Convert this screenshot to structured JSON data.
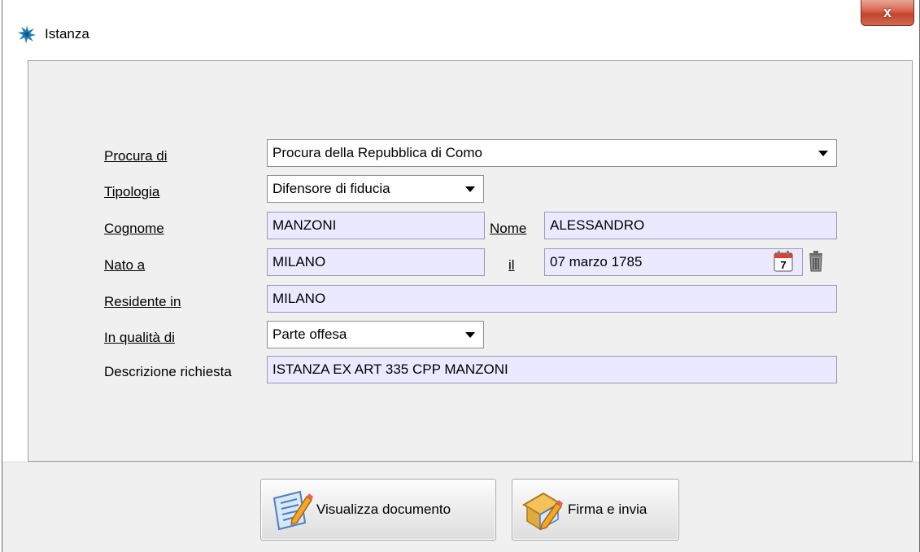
{
  "window": {
    "title": "Istanza",
    "close_label": "x"
  },
  "form": {
    "procura_label": "Procura di",
    "procura_value": "Procura della Repubblica di Como",
    "tipologia_label": "Tipologia",
    "tipologia_value": "Difensore di fiducia",
    "cognome_label": "Cognome",
    "cognome_value": "MANZONI",
    "nome_label": "Nome",
    "nome_value": "ALESSANDRO",
    "nato_label": "Nato a",
    "nato_value": "MILANO",
    "il_label": "il",
    "date_value": "07 marzo 1785",
    "calendar_day": "7",
    "residente_label": "Residente in",
    "residente_value": "MILANO",
    "qualita_label": "In qualità di",
    "qualita_value": "Parte offesa",
    "descrizione_label": "Descrizione richiesta",
    "descrizione_value": "ISTANZA EX ART 335 CPP MANZONI"
  },
  "buttons": {
    "visualizza_label": "Visualizza documento",
    "firma_label": "Firma e invia"
  },
  "icons": {
    "app": "app-logo-icon",
    "calendar": "calendar-icon",
    "trash": "trash-icon",
    "document": "edit-document-icon",
    "sign": "sign-send-icon"
  },
  "colors": {
    "field_bg": "#ebe9ff",
    "panel_bg": "#f0f0f0",
    "close_button": "#c4452d"
  }
}
